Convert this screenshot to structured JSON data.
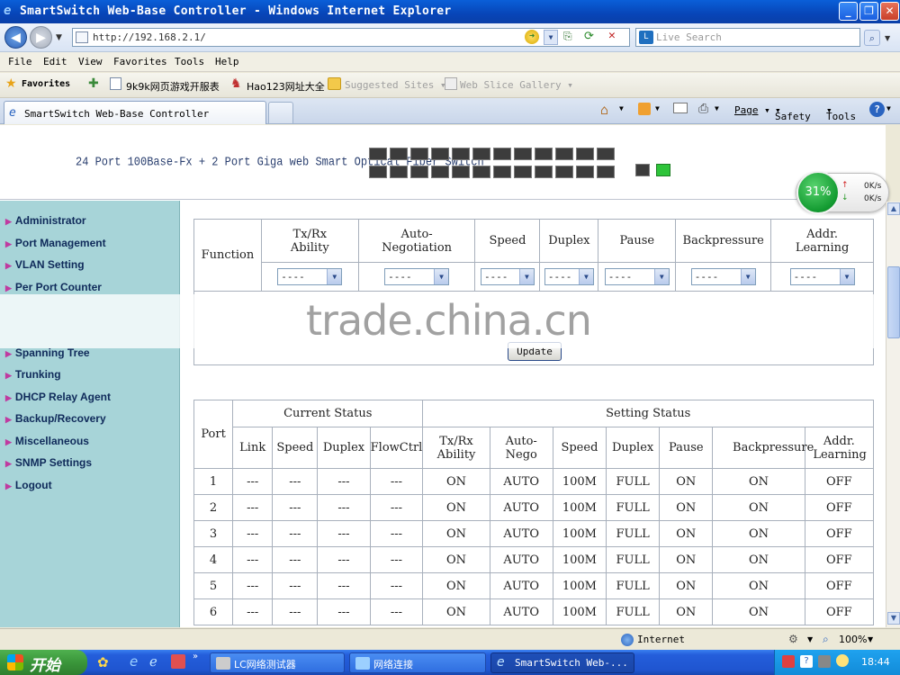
{
  "window": {
    "title": "SmartSwitch Web-Base Controller - Windows Internet Explorer"
  },
  "address_bar": {
    "url": "http://192.168.2.1/",
    "search_placeholder": "Live Search"
  },
  "menu": [
    "File",
    "Edit",
    "View",
    "Favorites",
    "Tools",
    "Help"
  ],
  "favorites_bar": {
    "favorites_label": "Favorites",
    "links": [
      "9k9k网页游戏开服表",
      "Hao123网址大全",
      "Suggested Sites",
      "Web Slice Gallery"
    ]
  },
  "tab": {
    "title": "SmartSwitch Web-Base Controller"
  },
  "command_bar": {
    "page": "Page",
    "safety": "Safety",
    "tools": "Tools"
  },
  "banner": {
    "title": "24 Port 100Base-Fx + 2 Port Giga web Smart Optical Fiber Switch",
    "ports_top_row": 12,
    "ports_bottom_row": 12,
    "giga_ports": [
      "off",
      "on"
    ]
  },
  "sidebar": {
    "items": [
      "Administrator",
      "Port Management",
      "VLAN Setting",
      "Per Port Counter",
      "",
      "Spanning Tree",
      "Trunking",
      "DHCP Relay Agent",
      "Backup/Recovery",
      "Miscellaneous",
      "SNMP Settings",
      "Logout"
    ]
  },
  "settings_table": {
    "function_label": "Function",
    "headers": [
      "Tx/Rx Ability",
      "Auto-Negotiation",
      "Speed",
      "Duplex",
      "Pause",
      "Backpressure",
      "Addr. Learning"
    ],
    "select_value": "----",
    "update_button": "Update"
  },
  "status_table": {
    "port_label": "Port",
    "current_status_label": "Current Status",
    "setting_status_label": "Setting Status",
    "current_headers": [
      "Link",
      "Speed",
      "Duplex",
      "FlowCtrl"
    ],
    "setting_headers": [
      "Tx/Rx Ability",
      "Auto-Nego",
      "Speed",
      "Duplex",
      "Pause",
      "Backpressure",
      "Addr. Learning"
    ],
    "rows": [
      [
        "1",
        "---",
        "---",
        "---",
        "---",
        "ON",
        "AUTO",
        "100M",
        "FULL",
        "ON",
        "ON",
        "OFF"
      ],
      [
        "2",
        "---",
        "---",
        "---",
        "---",
        "ON",
        "AUTO",
        "100M",
        "FULL",
        "ON",
        "ON",
        "OFF"
      ],
      [
        "3",
        "---",
        "---",
        "---",
        "---",
        "ON",
        "AUTO",
        "100M",
        "FULL",
        "ON",
        "ON",
        "OFF"
      ],
      [
        "4",
        "---",
        "---",
        "---",
        "---",
        "ON",
        "AUTO",
        "100M",
        "FULL",
        "ON",
        "ON",
        "OFF"
      ],
      [
        "5",
        "---",
        "---",
        "---",
        "---",
        "ON",
        "AUTO",
        "100M",
        "FULL",
        "ON",
        "ON",
        "OFF"
      ],
      [
        "6",
        "---",
        "---",
        "---",
        "---",
        "ON",
        "AUTO",
        "100M",
        "FULL",
        "ON",
        "ON",
        "OFF"
      ]
    ]
  },
  "watermark": "trade.china.cn",
  "net_meter": {
    "percent": "31%",
    "up": "0K/s",
    "down": "0K/s"
  },
  "status_bar": {
    "zone": "Internet",
    "zoom": "100%"
  },
  "taskbar": {
    "start": "开始",
    "buttons": [
      "LC网络测试器",
      "网络连接",
      "SmartSwitch Web-..."
    ],
    "clock": "18:44"
  },
  "colors": {
    "sidebar_bg": "#a7d4d8",
    "titlebar": "#0745b8",
    "taskbar": "#245edb",
    "led_active": "#2ec43a"
  }
}
